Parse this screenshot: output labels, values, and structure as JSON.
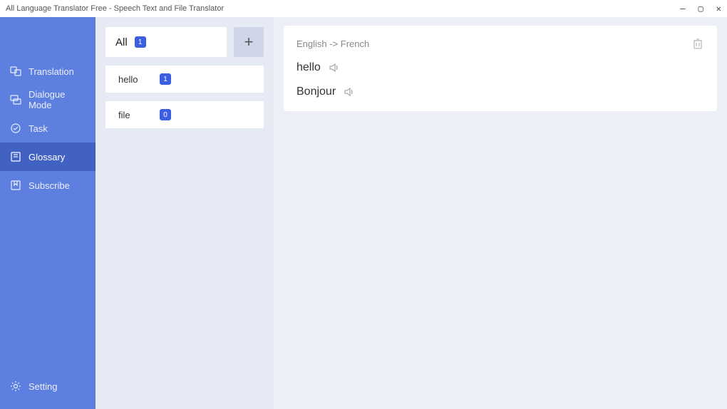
{
  "window": {
    "title": "All Language Translator Free - Speech Text and File Translator"
  },
  "sidebar": {
    "items": [
      {
        "label": "Translation"
      },
      {
        "label": "Dialogue Mode"
      },
      {
        "label": "Task"
      },
      {
        "label": "Glossary"
      },
      {
        "label": "Subscribe"
      }
    ],
    "setting_label": "Setting"
  },
  "glossary": {
    "all_label": "All",
    "all_count": "1",
    "add_label": "+",
    "entries": [
      {
        "name": "hello",
        "count": "1"
      },
      {
        "name": "file",
        "count": "0"
      }
    ]
  },
  "detail": {
    "langs": "English -> French",
    "source_word": "hello",
    "target_word": "Bonjour"
  }
}
